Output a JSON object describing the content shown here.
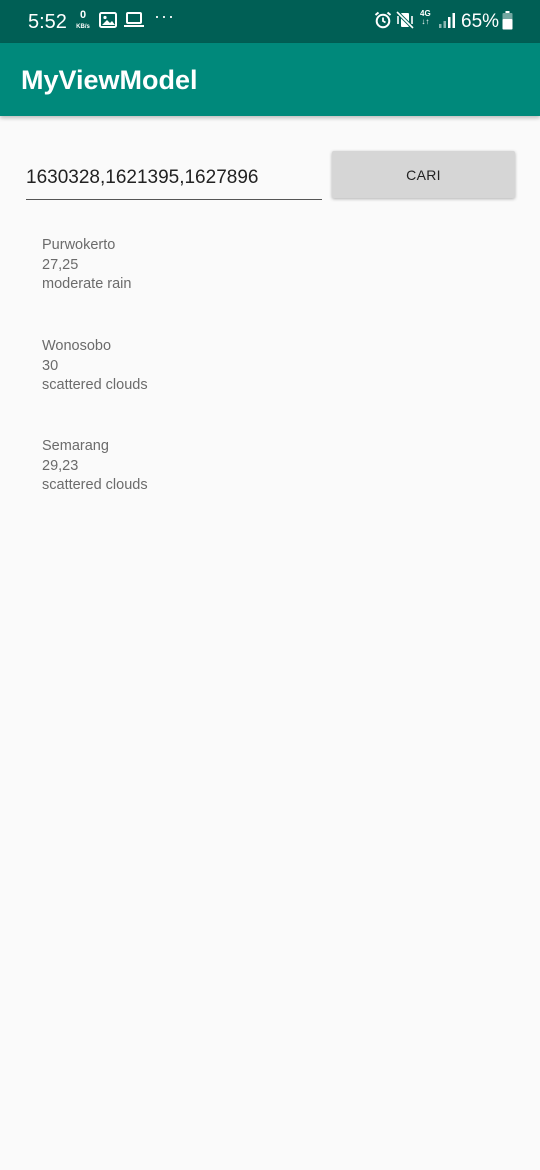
{
  "status_bar": {
    "time": "5:52",
    "speed_value": "0",
    "speed_unit": "KB/s",
    "overflow": "···",
    "network": "4G",
    "battery": "65%"
  },
  "app_bar": {
    "title": "MyViewModel"
  },
  "search": {
    "value": "1630328,1621395,1627896",
    "button_label": "CARI"
  },
  "results": [
    {
      "city": "Purwokerto",
      "temp": "27,25",
      "desc": "moderate rain"
    },
    {
      "city": "Wonosobo",
      "temp": "30",
      "desc": "scattered clouds"
    },
    {
      "city": "Semarang",
      "temp": "29,23",
      "desc": "scattered clouds"
    }
  ],
  "colors": {
    "status_bar": "#005f55",
    "app_bar": "#00897b",
    "background": "#fafafa",
    "button": "#d6d6d6"
  }
}
